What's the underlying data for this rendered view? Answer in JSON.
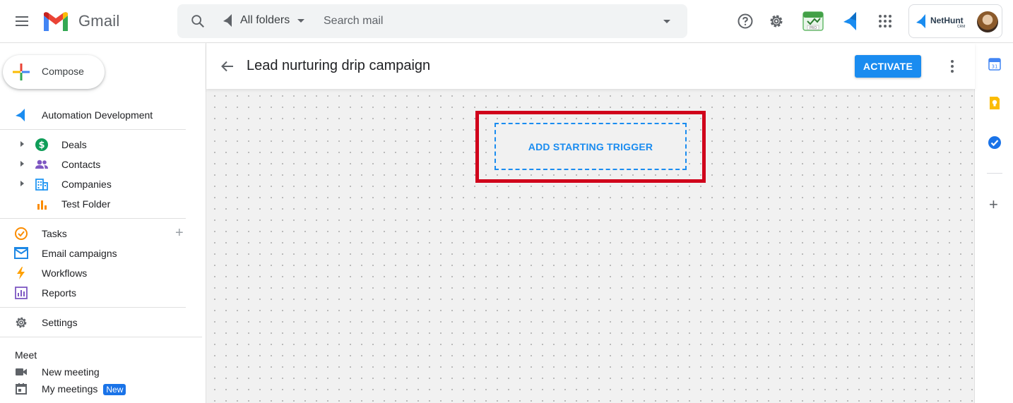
{
  "app": {
    "name": "Gmail"
  },
  "search": {
    "folder_label": "All folders",
    "placeholder": "Search mail"
  },
  "compose": {
    "label": "Compose"
  },
  "sidebar": {
    "section_title": "Automation Development",
    "folders": [
      {
        "label": "Deals",
        "icon": "dollar-icon",
        "color": "#0f9d58"
      },
      {
        "label": "Contacts",
        "icon": "contacts-icon",
        "color": "#7e57c2"
      },
      {
        "label": "Companies",
        "icon": "building-icon",
        "color": "#2196f3"
      },
      {
        "label": "Test Folder",
        "icon": "bar-chart-icon",
        "color": "#fb8c00"
      }
    ],
    "tools": [
      {
        "label": "Tasks",
        "icon": "check-circle-icon",
        "color": "#fb8c00"
      },
      {
        "label": "Email campaigns",
        "icon": "mail-icon",
        "color": "#1e88e5"
      },
      {
        "label": "Workflows",
        "icon": "lightning-icon",
        "color": "#ffa000"
      },
      {
        "label": "Reports",
        "icon": "report-icon",
        "color": "#7e57c2"
      }
    ],
    "settings_label": "Settings",
    "meet": {
      "title": "Meet",
      "new_meeting": "New meeting",
      "my_meetings": "My meetings",
      "badge": "New"
    }
  },
  "header": {
    "title": "Lead nurturing drip campaign",
    "activate_label": "ACTIVATE"
  },
  "canvas": {
    "trigger_label": "ADD STARTING TRIGGER"
  },
  "account": {
    "brand": "NetHunt",
    "brand_sub": "CRM"
  },
  "colors": {
    "accent": "#1a8cf0",
    "highlight": "#d0021b",
    "canvas_bg": "#f1f1f1"
  }
}
